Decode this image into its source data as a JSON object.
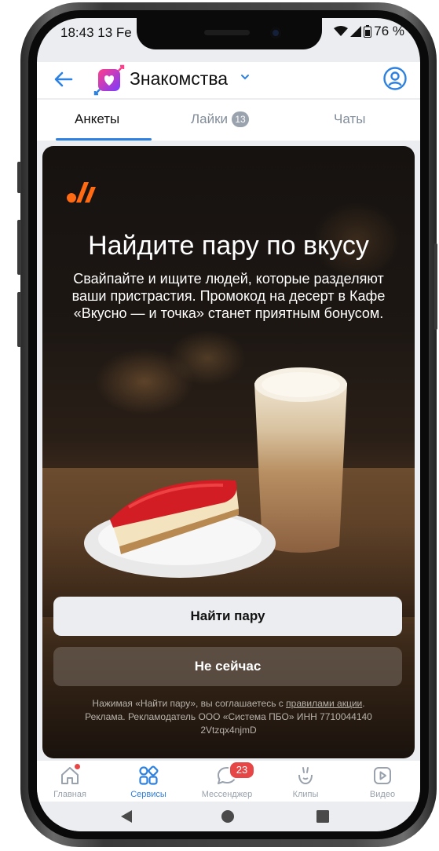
{
  "status_bar": {
    "time": "18:43",
    "date": "13 Fe",
    "battery": "76 %"
  },
  "header": {
    "title": "Знакомства"
  },
  "tabs": [
    {
      "label": "Анкеты"
    },
    {
      "label": "Лайки",
      "badge": "13"
    },
    {
      "label": "Чаты"
    }
  ],
  "promo": {
    "title": "Найдите пару по вкусу",
    "text": "Свайпайте и ищите людей, которые разделяют ваши пристрастия. Промокод на десерт в Кафе «Вкусно — и точка» станет приятным бонусом.",
    "primary_button": "Найти пару",
    "secondary_button": "Не сейчас",
    "disclaimer_prefix": "Нажимая «Найти пару», вы соглашаетесь с ",
    "disclaimer_link": "правилами акции",
    "disclaimer_suffix": ".",
    "ad_line": "Реклама. Рекламодатель ООО «Система ПБО» ИНН 7710044140",
    "ad_code": "2Vtzqx4njmD"
  },
  "bottom_nav": [
    {
      "label": "Главная",
      "icon": "home-icon"
    },
    {
      "label": "Сервисы",
      "icon": "services-icon"
    },
    {
      "label": "Мессенджер",
      "icon": "messenger-icon",
      "badge": "23"
    },
    {
      "label": "Клипы",
      "icon": "clips-icon"
    },
    {
      "label": "Видео",
      "icon": "video-icon"
    }
  ],
  "colors": {
    "accent": "#2d81e0",
    "badge_red": "#e64646",
    "brand_orange": "#ff6a13"
  }
}
